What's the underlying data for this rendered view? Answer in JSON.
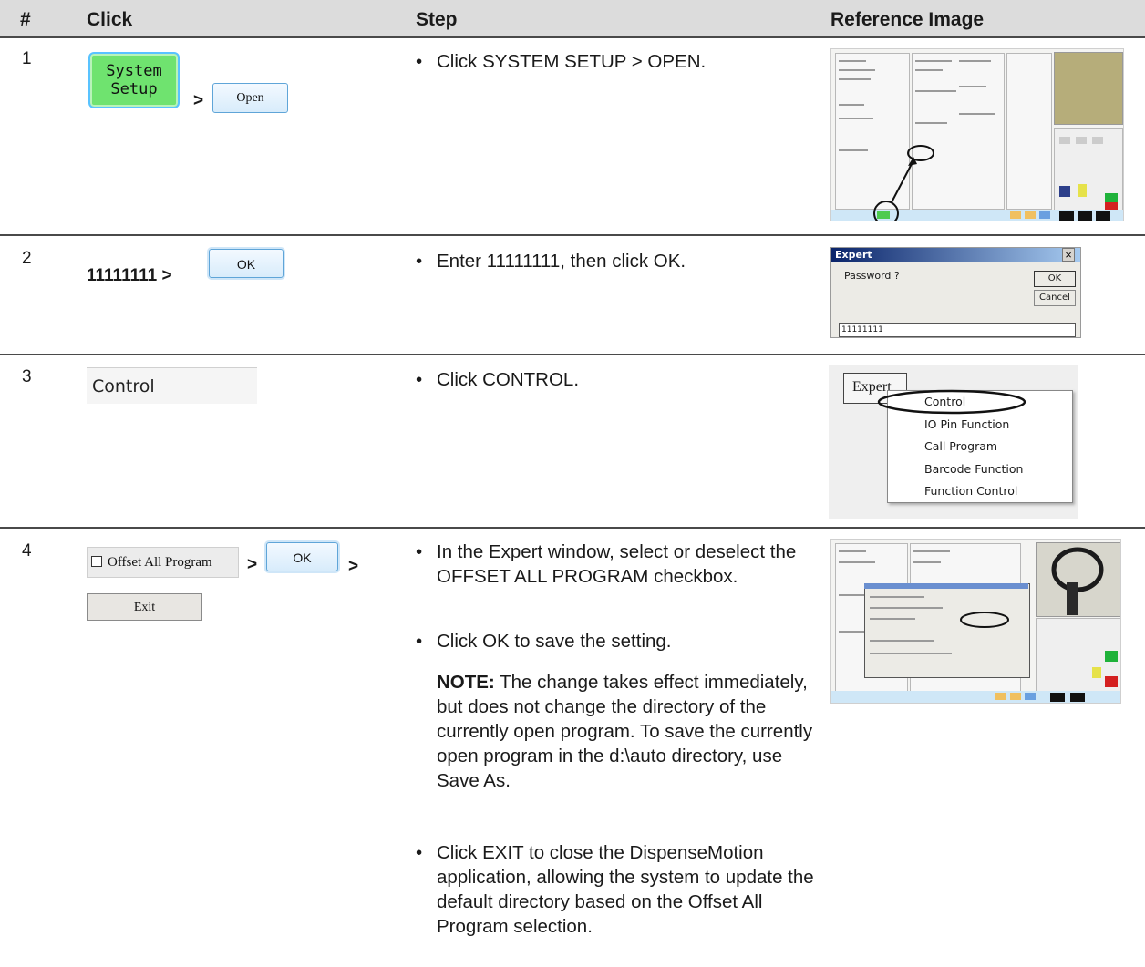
{
  "header": {
    "col_num": "#",
    "col_click": "Click",
    "col_step": "Step",
    "col_ref": "Reference Image"
  },
  "rows": [
    {
      "num": "1",
      "click": {
        "button1": "System Setup",
        "sep": ">",
        "button2": "Open"
      },
      "steps": [
        "Click SYSTEM SETUP > OPEN."
      ]
    },
    {
      "num": "2",
      "click": {
        "prefix": "11111111 >",
        "button": "OK"
      },
      "steps": [
        "Enter 11111111, then click OK."
      ],
      "ref": {
        "title": "Expert",
        "close": "×",
        "prompt": "Password ?",
        "ok": "OK",
        "cancel": "Cancel",
        "value": "11111111"
      }
    },
    {
      "num": "3",
      "click": {
        "item": "Control"
      },
      "steps": [
        "Click CONTROL."
      ],
      "ref": {
        "menu_button": "Expert",
        "items": [
          "Control",
          "IO Pin Function",
          "Call Program",
          "Barcode Function",
          "Function Control"
        ]
      }
    },
    {
      "num": "4",
      "click": {
        "checkbox": "Offset All Program",
        "sep1": ">",
        "button": "OK",
        "sep2": ">",
        "exit": "Exit"
      },
      "steps": [
        "In the Expert window, select or deselect the OFFSET ALL PROGRAM checkbox.",
        "Click OK to save the setting.",
        "Click EXIT to close the DispenseMotion application, allowing the system to update the default directory based on the Offset All Program selection."
      ],
      "note": {
        "label": "NOTE:",
        "text": "The change takes effect immediately, but does not change the directory of the currently open program. To save the currently open program in the d:\\auto directory, use Save As."
      }
    }
  ],
  "bullet": "•"
}
